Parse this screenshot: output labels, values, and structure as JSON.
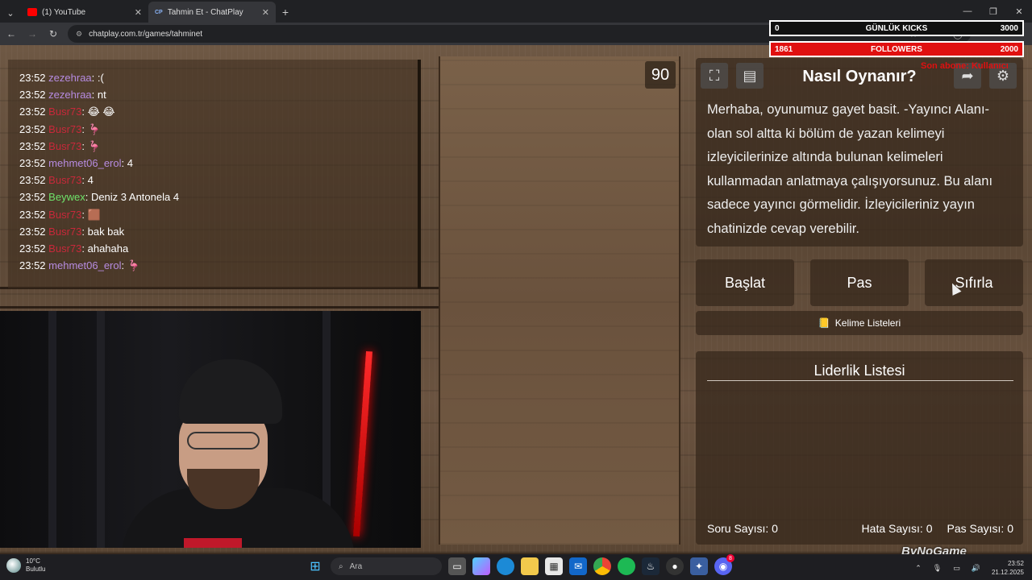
{
  "browser": {
    "tabs": [
      {
        "label": "(1) YouTube",
        "active": false,
        "icon": "youtube-icon",
        "color": "#ff0000"
      },
      {
        "label": "Tahmin Et - ChatPlay",
        "active": true,
        "icon": "chatplay-icon",
        "color": "#3a6ec8"
      }
    ],
    "tab_prefix": "CP",
    "url": "chatplay.com.tr/games/tahminet"
  },
  "chat": {
    "lines": [
      {
        "time": "23:52",
        "user": "zezehraa",
        "msg": ":(",
        "color": "purple"
      },
      {
        "time": "23:52",
        "user": "zezehraa",
        "msg": "nt",
        "color": "purple"
      },
      {
        "time": "23:52",
        "user": "Busr73",
        "msg": "😂 😂",
        "color": "red"
      },
      {
        "time": "23:52",
        "user": "Busr73",
        "msg": "🦩",
        "color": "red"
      },
      {
        "time": "23:52",
        "user": "Busr73",
        "msg": "🦩",
        "color": "red"
      },
      {
        "time": "23:52",
        "user": "mehmet06_erol",
        "msg": "4",
        "color": "purple"
      },
      {
        "time": "23:52",
        "user": "Busr73",
        "msg": "4",
        "color": "red"
      },
      {
        "time": "23:52",
        "user": "Beywex",
        "msg": "Deniz 3 Antonela 4",
        "color": "green"
      },
      {
        "time": "23:52",
        "user": "Busr73",
        "msg": "🟫",
        "color": "red"
      },
      {
        "time": "23:52",
        "user": "Busr73",
        "msg": "bak bak",
        "color": "red"
      },
      {
        "time": "23:52",
        "user": "Busr73",
        "msg": "ahahaha",
        "color": "red"
      },
      {
        "time": "23:52",
        "user": "mehmet06_erol",
        "msg": "🦩",
        "color": "purple"
      }
    ]
  },
  "game": {
    "timer": "90",
    "howto_title": "Nasıl Oynanır?",
    "howto_text": "Merhaba, oyunumuz gayet basit. -Yayıncı Alanı- olan sol altta ki bölüm de yazan kelimeyi izleyicilerinize altında bulunan kelimeleri kullanmadan anlatmaya çalışıyorsunuz. Bu alanı sadece yayıncı görmelidir. İzleyicileriniz yayın chatinizde cevap verebilir.",
    "buttons": {
      "start": "Başlat",
      "pass": "Pas",
      "reset": "Sıfırla"
    },
    "word_lists": "Kelime Listeleri",
    "leaderboard_title": "Liderlik Listesi",
    "stats": {
      "questions_label": "Soru Sayısı:",
      "questions": "0",
      "errors_label": "Hata Sayısı:",
      "errors": "0",
      "passes_label": "Pas Sayısı:",
      "passes": "0"
    }
  },
  "overlay": {
    "goal1": {
      "current": "0",
      "label": "GÜNLÜK KICKS",
      "target": "3000"
    },
    "goal2": {
      "current": "1861",
      "label": "FOLLOWERS",
      "target": "2000"
    },
    "red_text": "Son abone: Kullanıcı",
    "watermark": "ByNoGame"
  },
  "taskbar": {
    "weather_temp": "10°C",
    "weather_desc": "Bulutlu",
    "search_placeholder": "Ara",
    "time": "23:52",
    "date": "21.12.2025",
    "discord_badge": "8"
  },
  "colors": {
    "purple_user": "#b68be0",
    "red_user": "#c8283a",
    "green_user": "#6fe36b",
    "goal_red": "#e01010"
  }
}
